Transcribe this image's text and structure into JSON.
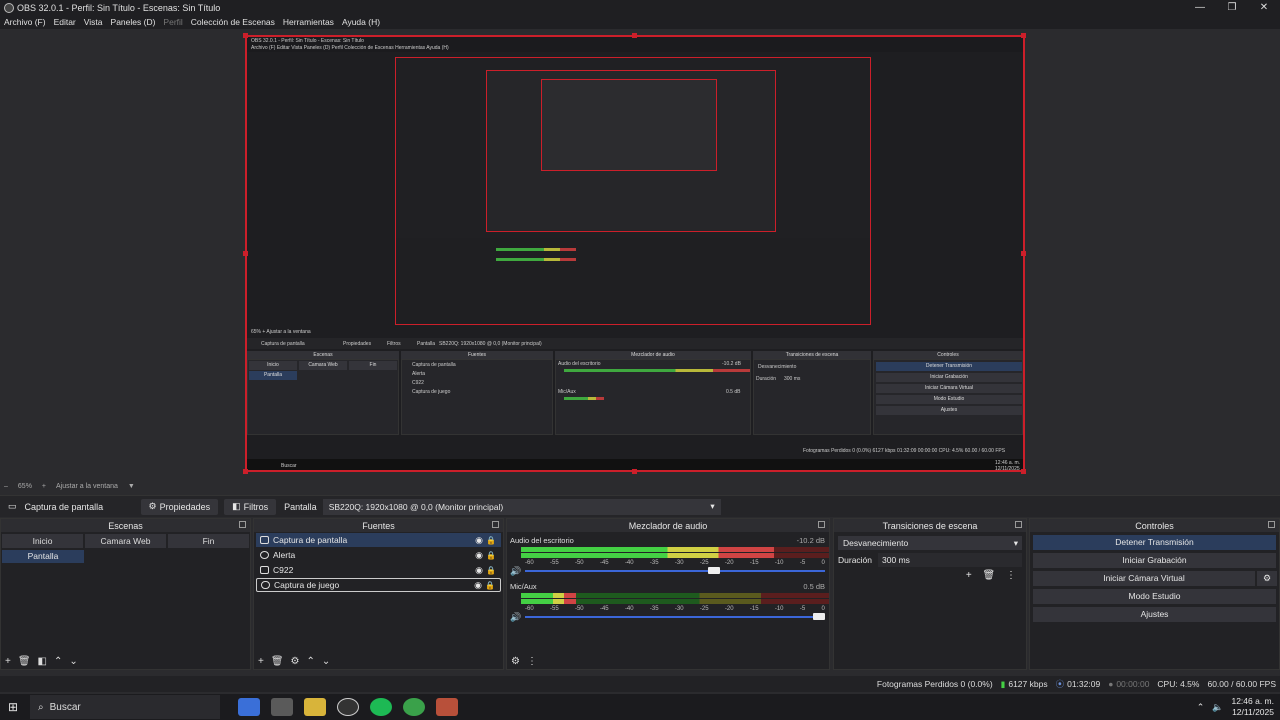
{
  "window": {
    "title": "OBS 32.0.1 - Perfil: Sin Título - Escenas: Sin Título",
    "controls": [
      "—",
      "❐",
      "✕"
    ]
  },
  "menu": [
    {
      "label": "Archivo (F)",
      "disabled": false
    },
    {
      "label": "Editar",
      "disabled": false
    },
    {
      "label": "Vista",
      "disabled": false
    },
    {
      "label": "Paneles (D)",
      "disabled": false
    },
    {
      "label": "Perfil",
      "disabled": true
    },
    {
      "label": "Colección de Escenas",
      "disabled": false
    },
    {
      "label": "Herramientas",
      "disabled": false
    },
    {
      "label": "Ayuda (H)",
      "disabled": false
    }
  ],
  "preview": {
    "nested_title": "OBS 32.0.1 - Perfil: Sin Título - Escenas: Sin Título",
    "nested_menu": "Archivo (F)   Editar   Vista   Paneles (D)   Perfil   Colección de Escenas   Herramientas   Ayuda (H)",
    "nested_zoom": "65%   +   Ajustar a la ventana",
    "nested_source": "Captura de pantalla",
    "nested_props": "Propiedades",
    "nested_filters": "Filtros",
    "nested_screen_label": "Pantalla",
    "nested_screen_value": "SB220Q: 1920x1080 @ 0,0 (Monitor principal)",
    "nested_docks": [
      "Escenas",
      "Fuentes",
      "Mezclador de audio",
      "Transiciones de escena",
      "Controles"
    ],
    "nested_scene_tabs": [
      "Inicio",
      "Camara Web",
      "Fin"
    ],
    "nested_scene": "Pantalla",
    "nested_sources": [
      "Captura de pantalla",
      "Alerta",
      "C922",
      "Captura de juego"
    ],
    "nested_channel1": "Audio del escritorio",
    "nested_channel1_db": "-10.2 dB",
    "nested_channel2": "Mic/Aux",
    "nested_channel2_db": "0.5 dB",
    "nested_transition": "Desvanecimiento",
    "nested_duration_label": "Duración",
    "nested_duration": "300 ms",
    "nested_controls": [
      "Detener Transmisión",
      "Iniciar Grabación",
      "Iniciar Cámara Virtual",
      "Modo Estudio",
      "Ajustes"
    ],
    "nested_status": "Fotogramas Perdidos 0 (0.0%)   6127 kbps   01:32:09   00:00:00   CPU: 4.5%   60.00 / 60.00 FPS",
    "nested_search": "Buscar",
    "nested_clock": "12:46 a. m.",
    "nested_date": "12/11/2025"
  },
  "zoom": {
    "level": "65%",
    "plus": "+",
    "fit": "Ajustar a la ventana",
    "caret": "▼"
  },
  "source_toolbar": {
    "source_name": "Captura de pantalla",
    "properties": "Propiedades",
    "filters": "Filtros",
    "screen_label": "Pantalla",
    "screen_value": "SB220Q: 1920x1080 @ 0,0 (Monitor principal)"
  },
  "scenes": {
    "title": "Escenas",
    "tabs": [
      "Inicio",
      "Camara Web",
      "Fin"
    ],
    "selected": "Pantalla"
  },
  "sources": {
    "title": "Fuentes",
    "items": [
      {
        "label": "Captura de pantalla",
        "selected": true
      },
      {
        "label": "Alerta",
        "selected": false
      },
      {
        "label": "C922",
        "selected": false
      },
      {
        "label": "Captura de juego",
        "selected": false
      }
    ]
  },
  "mixer": {
    "title": "Mezclador de audio",
    "channels": [
      {
        "name": "Audio del escritorio",
        "db": "-10.2 dB",
        "level": 0.82,
        "volume": 0.65
      },
      {
        "name": "Mic/Aux",
        "db": "0.5 dB",
        "level": 0.18,
        "volume": 1.0
      }
    ],
    "ticks": [
      "-60",
      "-55",
      "-50",
      "-45",
      "-40",
      "-35",
      "-30",
      "-25",
      "-20",
      "-15",
      "-10",
      "-5",
      "0"
    ]
  },
  "transitions": {
    "title": "Transiciones de escena",
    "selected": "Desvanecimiento",
    "duration_label": "Duración",
    "duration": "300 ms"
  },
  "controls": {
    "title": "Controles",
    "stream": "Detener Transmisión",
    "record": "Iniciar Grabación",
    "virtualcam": "Iniciar Cámara Virtual",
    "studio": "Modo Estudio",
    "settings": "Ajustes"
  },
  "status": {
    "dropped": "Fotogramas Perdidos 0 (0.0%)",
    "bitrate": "6127 kbps",
    "stream_time": "01:32:09",
    "record_time": "00:00:00",
    "cpu": "CPU: 4.5%",
    "fps": "60.00 / 60.00 FPS"
  },
  "taskbar": {
    "search": "Buscar",
    "time": "12:46 a. m.",
    "date": "12/11/2025"
  },
  "colors": {
    "accent_red": "#cc1f2a",
    "selected_blue": "#2b3d5c",
    "meter_green": "#44d044"
  }
}
